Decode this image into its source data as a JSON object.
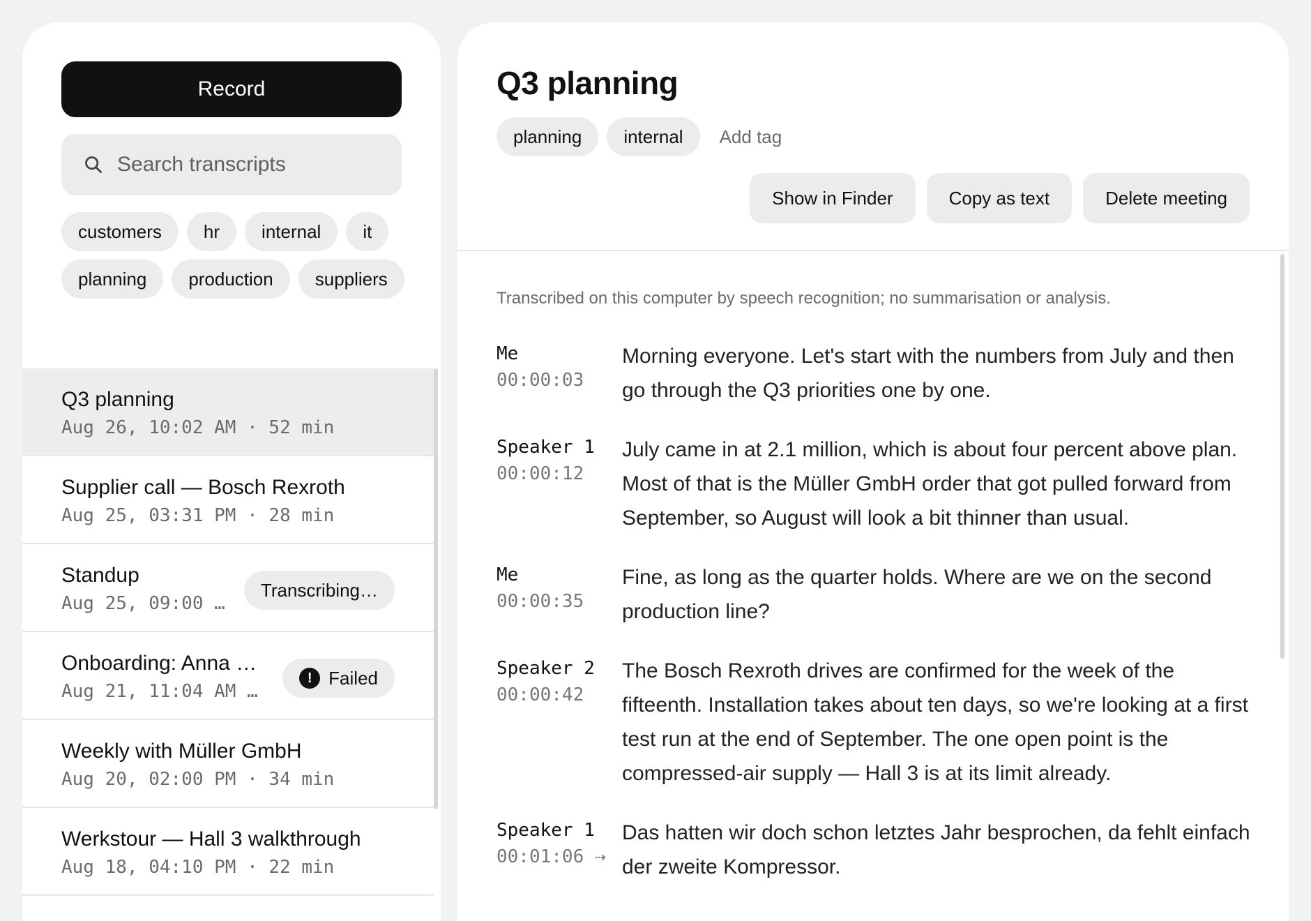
{
  "sidebar": {
    "record_label": "Record",
    "search_placeholder": "Search transcripts",
    "tags": [
      "customers",
      "hr",
      "internal",
      "it",
      "planning",
      "production",
      "suppliers"
    ],
    "meetings": [
      {
        "title": "Q3 planning",
        "subtitle": "Aug 26, 10:02 AM · 52 min",
        "badge": "",
        "selected": true
      },
      {
        "title": "Supplier call — Bosch Rexroth",
        "subtitle": "Aug 25, 03:31 PM · 28 min",
        "badge": ""
      },
      {
        "title": "Standup",
        "subtitle": "Aug 25, 09:00 …",
        "badge": "Transcribing…"
      },
      {
        "title": "Onboarding: Anna …",
        "subtitle": "Aug 21, 11:04 AM …",
        "badge": "Failed",
        "badge_icon": "!"
      },
      {
        "title": "Weekly with Müller GmbH",
        "subtitle": "Aug 20, 02:00 PM · 34 min",
        "badge": ""
      },
      {
        "title": "Werkstour — Hall 3 walkthrough",
        "subtitle": "Aug 18, 04:10 PM · 22 min",
        "badge": ""
      }
    ]
  },
  "main": {
    "title": "Q3 planning",
    "tags": [
      "planning",
      "internal"
    ],
    "add_tag": "Add tag",
    "actions": {
      "show_in_finder": "Show in Finder",
      "copy_as_text": "Copy as text",
      "delete_meeting": "Delete meeting"
    },
    "notice": "Transcribed on this computer by speech recognition; no summarisation or analysis.",
    "transcript": [
      {
        "speaker": "Me",
        "time": "00:00:03",
        "text": "Morning everyone. Let's start with the numbers from July and then go through the Q3 priorities one by one."
      },
      {
        "speaker": "Speaker 1",
        "time": "00:00:12",
        "text": "July came in at 2.1 million, which is about four percent above plan. Most of that is the Müller GmbH order that got pulled forward from September, so August will look a bit thinner than usual."
      },
      {
        "speaker": "Me",
        "time": "00:00:35",
        "text": "Fine, as long as the quarter holds. Where are we on the second production line?"
      },
      {
        "speaker": "Speaker 2",
        "time": "00:00:42",
        "text": "The Bosch Rexroth drives are confirmed for the week of the fifteenth. Installation takes about ten days, so we're looking at a first test run at the end of September. The one open point is the compressed-air supply — Hall 3 is at its limit already."
      },
      {
        "speaker": "Speaker 1",
        "time": "00:01:06 ⇢",
        "text": "Das hatten wir doch schon letztes Jahr besprochen, da fehlt einfach der zweite Kompressor."
      }
    ]
  }
}
